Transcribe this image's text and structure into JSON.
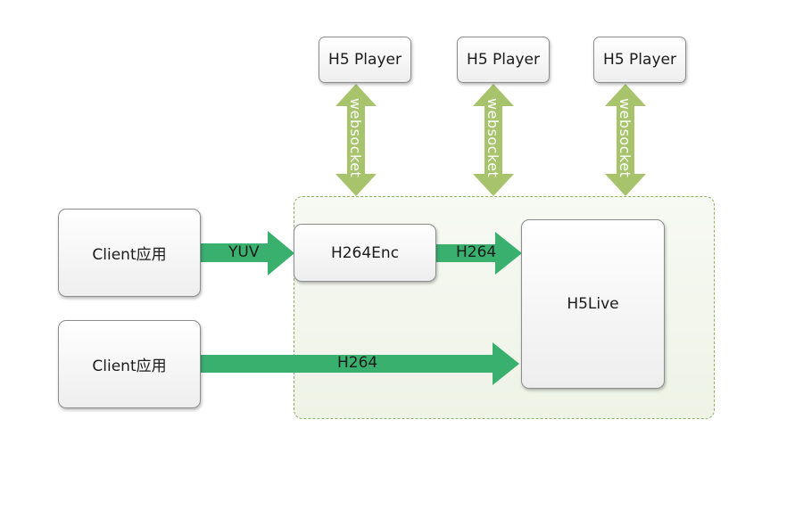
{
  "players": [
    {
      "label": "H5 Player"
    },
    {
      "label": "H5 Player"
    },
    {
      "label": "H5 Player"
    }
  ],
  "websocket_label": "websocket",
  "clients": [
    {
      "label": "Client应用"
    },
    {
      "label": "Client应用"
    }
  ],
  "encoder": {
    "label": "H264Enc"
  },
  "server": {
    "label": "H5Live"
  },
  "edges": {
    "yuv": "YUV",
    "enc_to_live": "H264",
    "client_to_live": "H264"
  },
  "colors": {
    "green_arrow": "#3ab06f",
    "ws_arrow": "#a7c46c",
    "group_border": "#8fb06a"
  }
}
